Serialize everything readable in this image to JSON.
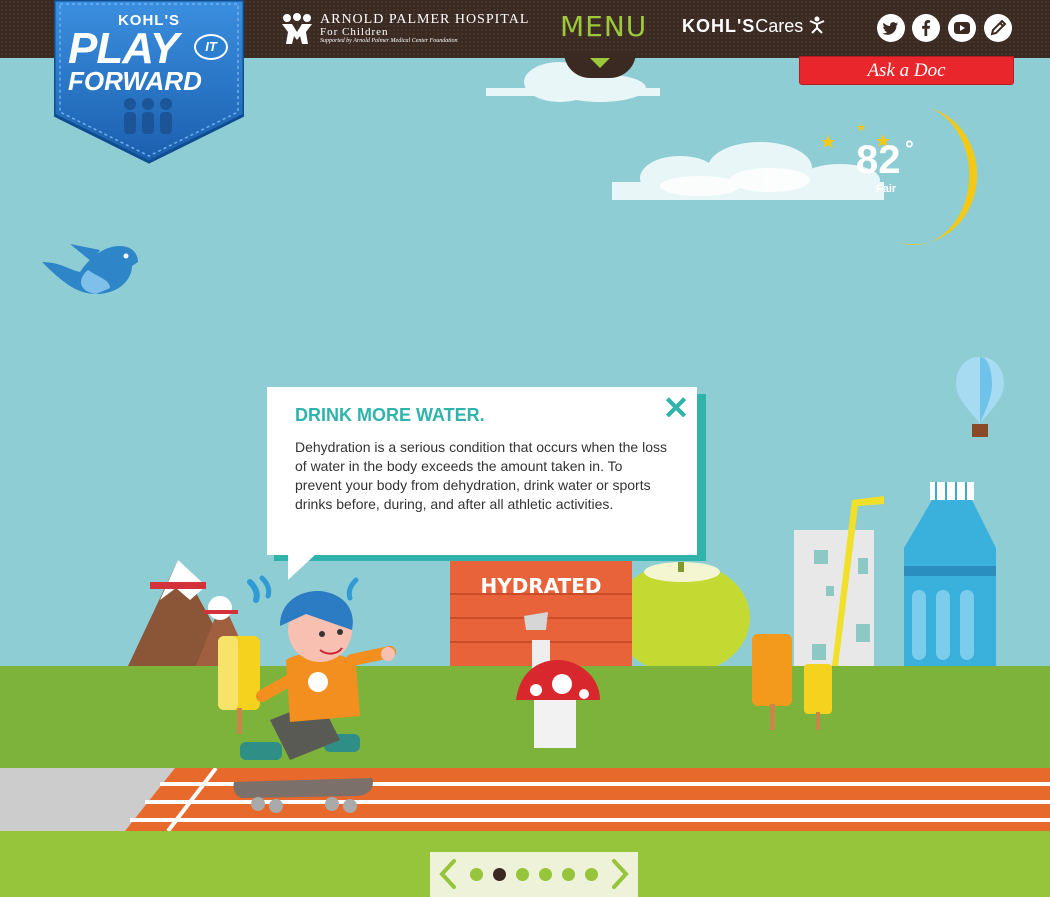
{
  "header": {
    "logo": {
      "brand": "KOHL'S",
      "play": "PLAY",
      "it": "IT",
      "forward": "FORWARD"
    },
    "hospital": {
      "title": "ARNOLD PALMER HOSPITAL",
      "subtitle": "For Children",
      "supported": "Supported by Arnold Palmer Medical Center Foundation"
    },
    "menu_label": "MENU",
    "kohls_cares": {
      "brand": "KOHL'S",
      "cares": "Cares"
    },
    "social": [
      {
        "icon": "twitter-icon"
      },
      {
        "icon": "facebook-icon"
      },
      {
        "icon": "youtube-icon"
      },
      {
        "icon": "pencil-icon"
      }
    ]
  },
  "ask_doc_label": "Ask a Doc",
  "weather": {
    "temperature": "82",
    "degree": "°",
    "condition": "Fair"
  },
  "popup": {
    "title": "DRINK MORE WATER.",
    "body": "Dehydration is a serious condition that occurs when the loss of water in the body exceeds the amount taken in. To prevent your body from dehydration, drink water or sports drinks before, during, and after all athletic activities.",
    "close_icon": "close-icon"
  },
  "billboard": {
    "text": "HYDRATED"
  },
  "pager": {
    "total": 6,
    "active_index": 1
  },
  "colors": {
    "sky": "#8fcdd4",
    "header": "#3b2a22",
    "menu_green": "#9bc93b",
    "accent_teal": "#2fb3ab",
    "ask_doc_red": "#e8262b",
    "grass": "#7db33a",
    "track": "#e7692c"
  }
}
